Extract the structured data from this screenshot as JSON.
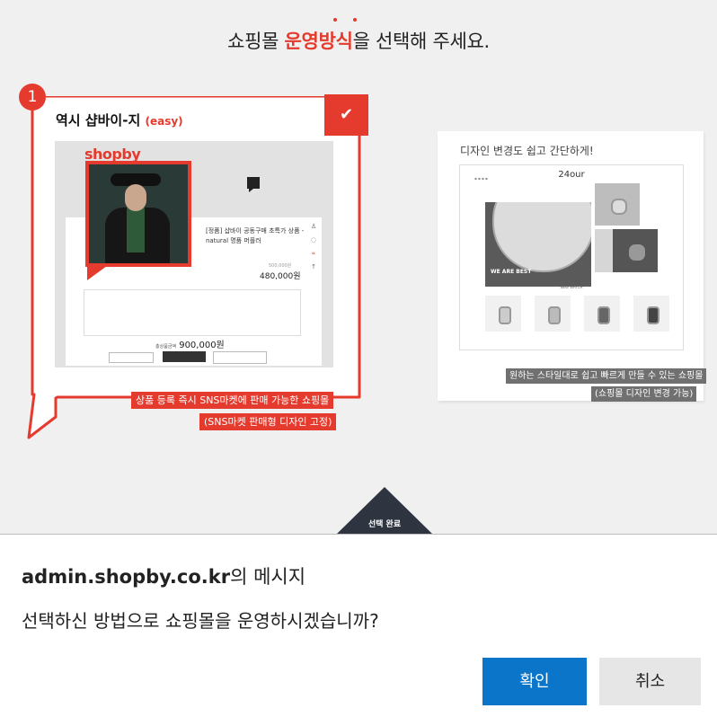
{
  "heading": {
    "prefix": "쇼핑몰 ",
    "highlight": "운영방식",
    "suffix": "을 선택해 주세요."
  },
  "colors": {
    "accent": "#e53b2e",
    "dark": "#2f3441",
    "primary_button": "#0b75c9",
    "caption_gray": "#707070"
  },
  "option1": {
    "badge": "1",
    "title": "역시 샵바이-지 ",
    "title_sub": "(easy)",
    "check_icon": "checkmark-icon",
    "preview": {
      "logo": "shopby",
      "product_name": "[정품] 샵바이 공동구매 초특가 상품 - natural 명품 머플러",
      "price_small": "500,000원",
      "price": "480,000원",
      "total_label": "총상품금액",
      "total": "900,000원"
    },
    "caption_line1": "상품 등록 즉시 SNS마켓에 판매 가능한 쇼핑몰",
    "caption_line2": "(SNS마켓 판매형 디자인 고정)"
  },
  "option2": {
    "title": "디자인 변경도 쉽고 간단하게!",
    "preview": {
      "logo": "24our",
      "hero_text": "WE ARE BEST",
      "section_label": "NEW WATCH"
    },
    "caption_line1": "원하는 스타일대로 쉽고 빠르게 만들 수 있는 쇼핑몰",
    "caption_line2": "(쇼핑몰 디자인 변경 가능)"
  },
  "confirm_tab": "선택 완료",
  "dialog": {
    "domain": "admin.shopby.co.kr",
    "title_suffix": "의 메시지",
    "message": "선택하신 방법으로 쇼핑몰을 운영하시겠습니까?",
    "ok_label": "확인",
    "cancel_label": "취소"
  }
}
